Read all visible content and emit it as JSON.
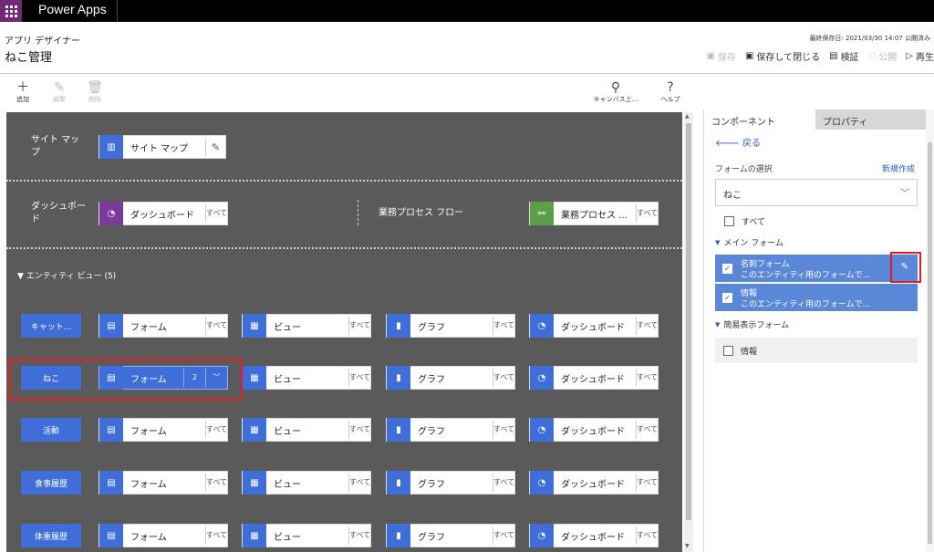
{
  "app": {
    "brand": "Power Apps"
  },
  "header": {
    "subtitle": "アプリ デザイナー",
    "title": "ねこ管理",
    "saved": "最終保存日: 2021/03/30 14:07 公開済み",
    "actions": [
      {
        "label": "保存",
        "icon": "save-icon",
        "disabled": true
      },
      {
        "label": "保存して閉じる",
        "icon": "save-close-icon",
        "disabled": false
      },
      {
        "label": "検証",
        "icon": "validate-icon",
        "disabled": false
      },
      {
        "label": "公開",
        "icon": "publish-icon",
        "disabled": true
      },
      {
        "label": "再生",
        "icon": "play-icon",
        "disabled": false
      }
    ]
  },
  "toolbar": {
    "add": "追加",
    "edit": "編集",
    "delete": "削除",
    "search": "キャンバス上...",
    "help": "ヘルプ"
  },
  "canvas": {
    "sitemap": {
      "label": "サイト マップ",
      "tile": "サイト マップ"
    },
    "dashboard": {
      "label": "ダッシュボード",
      "tile": "ダッシュボード",
      "all": "すべて"
    },
    "bpf": {
      "label": "業務プロセス フロー",
      "tile": "業務プロセス ...",
      "all": "すべて"
    },
    "entity_header": "エンティティ ビュー (5)",
    "entities": [
      {
        "name": "キャット...",
        "form": "フォーム",
        "view": "ビュー",
        "chart": "グラフ",
        "dash": "ダッシュボード",
        "all": "すべて"
      },
      {
        "name": "ねこ",
        "form": "フォーム",
        "form_count": "2",
        "view": "ビュー",
        "chart": "グラフ",
        "dash": "ダッシュボード",
        "all": "すべて"
      },
      {
        "name": "活動",
        "form": "フォーム",
        "view": "ビュー",
        "chart": "グラフ",
        "dash": "ダッシュボード",
        "all": "すべて"
      },
      {
        "name": "食事履歴",
        "form": "フォーム",
        "view": "ビュー",
        "chart": "グラフ",
        "dash": "ダッシュボード",
        "all": "すべて"
      },
      {
        "name": "体重履歴",
        "form": "フォーム",
        "view": "ビュー",
        "chart": "グラフ",
        "dash": "ダッシュボード",
        "all": "すべて"
      }
    ]
  },
  "panel": {
    "tab_components": "コンポーネント",
    "tab_properties": "プロパティ",
    "back": "戻る",
    "form_select": "フォームの選択",
    "new": "新規作成",
    "dropdown_value": "ねこ",
    "all": "すべて",
    "main_forms": "メイン フォーム",
    "forms": [
      {
        "name": "名刺フォーム",
        "desc": "このエンティティ用のフォームで..."
      },
      {
        "name": "情報",
        "desc": "このエンティティ用のフォームで..."
      }
    ],
    "quick_forms": "簡易表示フォーム",
    "quick_item": "情報"
  },
  "colors": {
    "form": "#3f6ed8",
    "dashboard": "#7a3a9a",
    "bpf": "#5aa04a",
    "canvas": "#5a5a5a",
    "highlight": "#e02020"
  }
}
